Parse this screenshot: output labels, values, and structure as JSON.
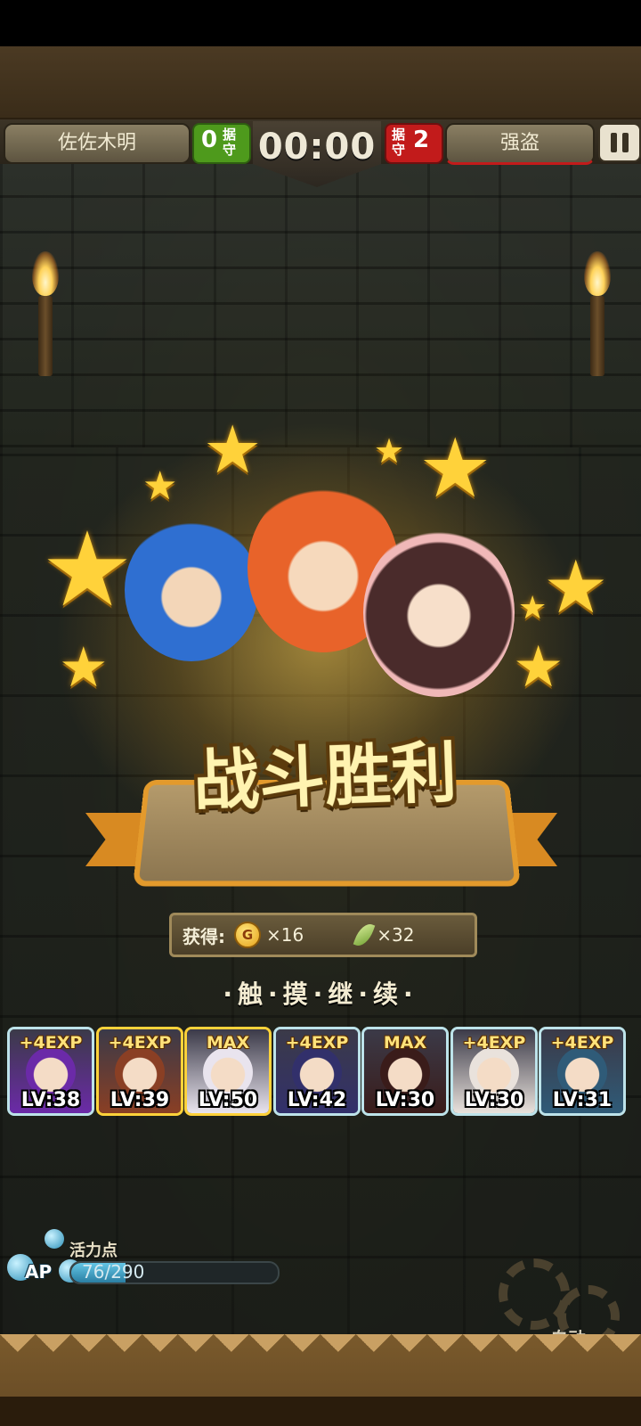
{
  "hud": {
    "player_name": "佐佐木明",
    "player_score": "0",
    "player_score_label": "据守",
    "timer": "00:00",
    "enemy_score": "2",
    "enemy_score_label": "据守",
    "enemy_name": "强盗",
    "pause_icon": "pause-icon"
  },
  "result": {
    "title": "战斗胜利"
  },
  "rewards": {
    "label": "获得:",
    "coin_icon_text": "G",
    "coin_amount": "×16",
    "item_amount": "×32"
  },
  "prompt": "·触·摸·继·续·",
  "heroes": [
    {
      "tag": "+4EXP",
      "level": "LV:38",
      "color": "#6b2aa8"
    },
    {
      "tag": "+4EXP",
      "level": "LV:39",
      "color": "#8a3f24"
    },
    {
      "tag": "MAX",
      "level": "LV:50",
      "color": "#e9e4ee"
    },
    {
      "tag": "+4EXP",
      "level": "LV:42",
      "color": "#32306b"
    },
    {
      "tag": "MAX",
      "level": "LV:30",
      "color": "#3a1c1a"
    },
    {
      "tag": "+4EXP",
      "level": "LV:30",
      "color": "#e9e2dc"
    },
    {
      "tag": "+4EXP",
      "level": "LV:31",
      "color": "#2f5b78"
    }
  ],
  "ap": {
    "label": "活力点",
    "abbrev": "AP",
    "value": "76/290",
    "fraction": 0.262
  },
  "auto_button": "自动",
  "colors": {
    "player_score_bg": "#4e9a1c",
    "enemy_score_bg": "#c21b1b",
    "accent_gold": "#ffd23a"
  }
}
